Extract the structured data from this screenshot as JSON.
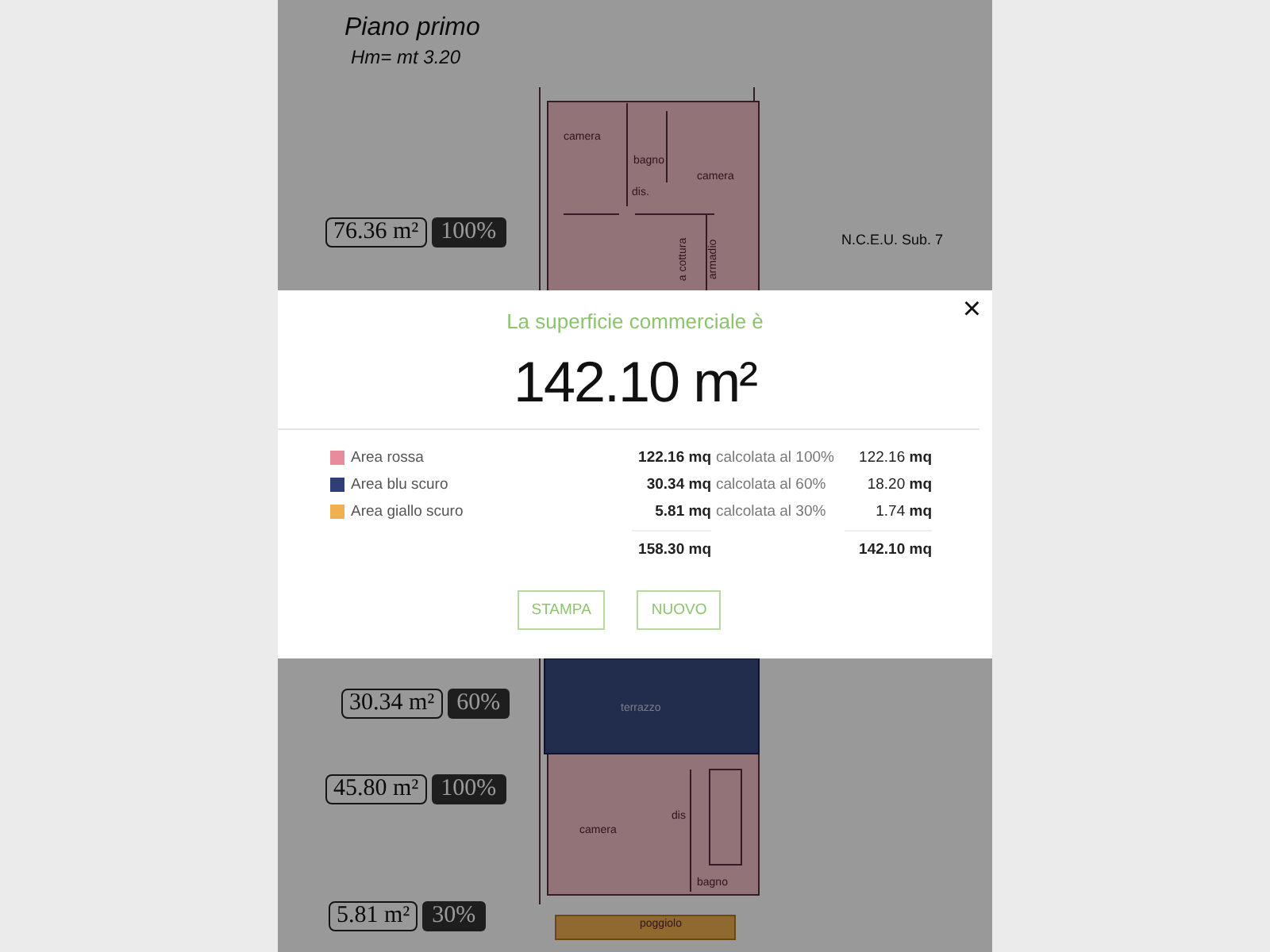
{
  "plan": {
    "title": "Piano primo",
    "height": "Hm= mt 3.20",
    "reference": "N.C.E.U. Sub. 7",
    "area_tags": [
      {
        "area": "76.36 m²",
        "percent": "100%"
      },
      {
        "area": "30.34 m²",
        "percent": "60%"
      },
      {
        "area": "45.80 m²",
        "percent": "100%"
      },
      {
        "area": "5.81 m²",
        "percent": "30%"
      }
    ],
    "rooms": [
      {
        "label": "camera",
        "kind": "flat"
      },
      {
        "label": "bagno",
        "kind": "flat"
      },
      {
        "label": "dis.",
        "kind": "flat"
      },
      {
        "label": "camera",
        "kind": "flat"
      },
      {
        "label": "a cottura",
        "kind": "vertical"
      },
      {
        "label": "armadio",
        "kind": "vertical"
      },
      {
        "label": "terrazzo",
        "kind": "flat"
      },
      {
        "label": "camera",
        "kind": "flat"
      },
      {
        "label": "dis",
        "kind": "flat"
      },
      {
        "label": "bagno",
        "kind": "flat"
      },
      {
        "label": "poggiolo",
        "kind": "flat"
      }
    ]
  },
  "dialog": {
    "title": "La superficie commerciale è",
    "total": "142.10 m²",
    "close": "×",
    "rows": [
      {
        "label": "Area rossa",
        "color": "#e88c9c",
        "area": "122.16 mq",
        "factor": "calcolata al 100%",
        "result": "122.16 **mq**"
      },
      {
        "label": "Area blu scuro",
        "color": "#2f3d78",
        "area": "30.34 mq",
        "factor": "calcolata al 60%",
        "result": "18.20 **mq**"
      },
      {
        "label": "Area giallo scuro",
        "color": "#f0b050",
        "area": "5.81 mq",
        "factor": "calcolata al 30%",
        "result": "1.74 **mq**"
      }
    ],
    "totals": {
      "area": "158.30 mq",
      "result": "142.10 mq"
    },
    "buttons": [
      "STAMPA",
      "NUOVO"
    ]
  }
}
